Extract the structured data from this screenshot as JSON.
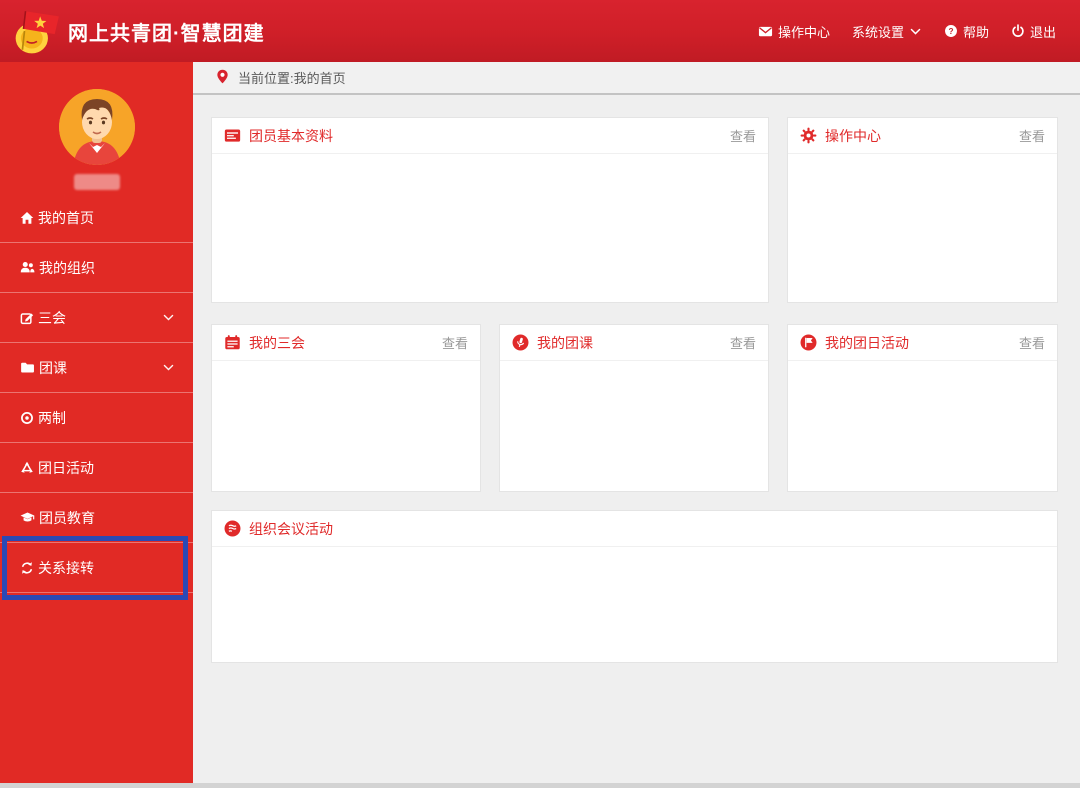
{
  "app": {
    "brand": "网上共青团·智慧团建",
    "logo_icon": "league-emblem-icon"
  },
  "header": {
    "nav": [
      {
        "label": "操作中心",
        "icon": "mail-icon"
      },
      {
        "label": "系统设置",
        "icon": "chevron-down-icon"
      },
      {
        "label": "帮助",
        "icon": "help-icon"
      },
      {
        "label": "退出",
        "icon": "power-icon"
      }
    ]
  },
  "sidebar": {
    "items": [
      {
        "label": "我的首页",
        "icon": "home-icon",
        "expandable": false,
        "highlighted": false
      },
      {
        "label": "我的组织",
        "icon": "users-icon",
        "expandable": false,
        "highlighted": false
      },
      {
        "label": "三会",
        "icon": "edit-icon",
        "expandable": true,
        "highlighted": false
      },
      {
        "label": "团课",
        "icon": "folder-icon",
        "expandable": true,
        "highlighted": false
      },
      {
        "label": "两制",
        "icon": "target-icon",
        "expandable": false,
        "highlighted": false
      },
      {
        "label": "团日活动",
        "icon": "recycle-icon",
        "expandable": false,
        "highlighted": false
      },
      {
        "label": "团员教育",
        "icon": "graduation-cap-icon",
        "expandable": false,
        "highlighted": false
      },
      {
        "label": "关系接转",
        "icon": "transfer-icon",
        "expandable": false,
        "highlighted": true
      }
    ],
    "avatar": "cartoon-boy-avatar",
    "username_blurred": true
  },
  "breadcrumb": {
    "label": "当前位置:我的首页",
    "icon": "location-pin-icon"
  },
  "cards": [
    {
      "title": "团员基本资料",
      "action": "查看",
      "icon": "id-card-icon"
    },
    {
      "title": "操作中心",
      "action": "查看",
      "icon": "gear-icon"
    },
    {
      "title": "我的三会",
      "action": "查看",
      "icon": "calendar-icon"
    },
    {
      "title": "我的团课",
      "action": "查看",
      "icon": "microphone-circle-icon"
    },
    {
      "title": "我的团日活动",
      "action": "查看",
      "icon": "flag-circle-icon"
    },
    {
      "title": "组织会议活动",
      "action": "",
      "icon": "meeting-list-circle-icon"
    }
  ],
  "annotation": {
    "highlighted_item": "关系接转",
    "color": "#2b49b4"
  },
  "colors": {
    "header_red": "#d2202b",
    "sidebar_red": "#e12a25",
    "card_title_red": "#e02a2a",
    "highlight_blue": "#2b49b4",
    "action_gray": "#999999",
    "content_bg": "#efefef"
  }
}
